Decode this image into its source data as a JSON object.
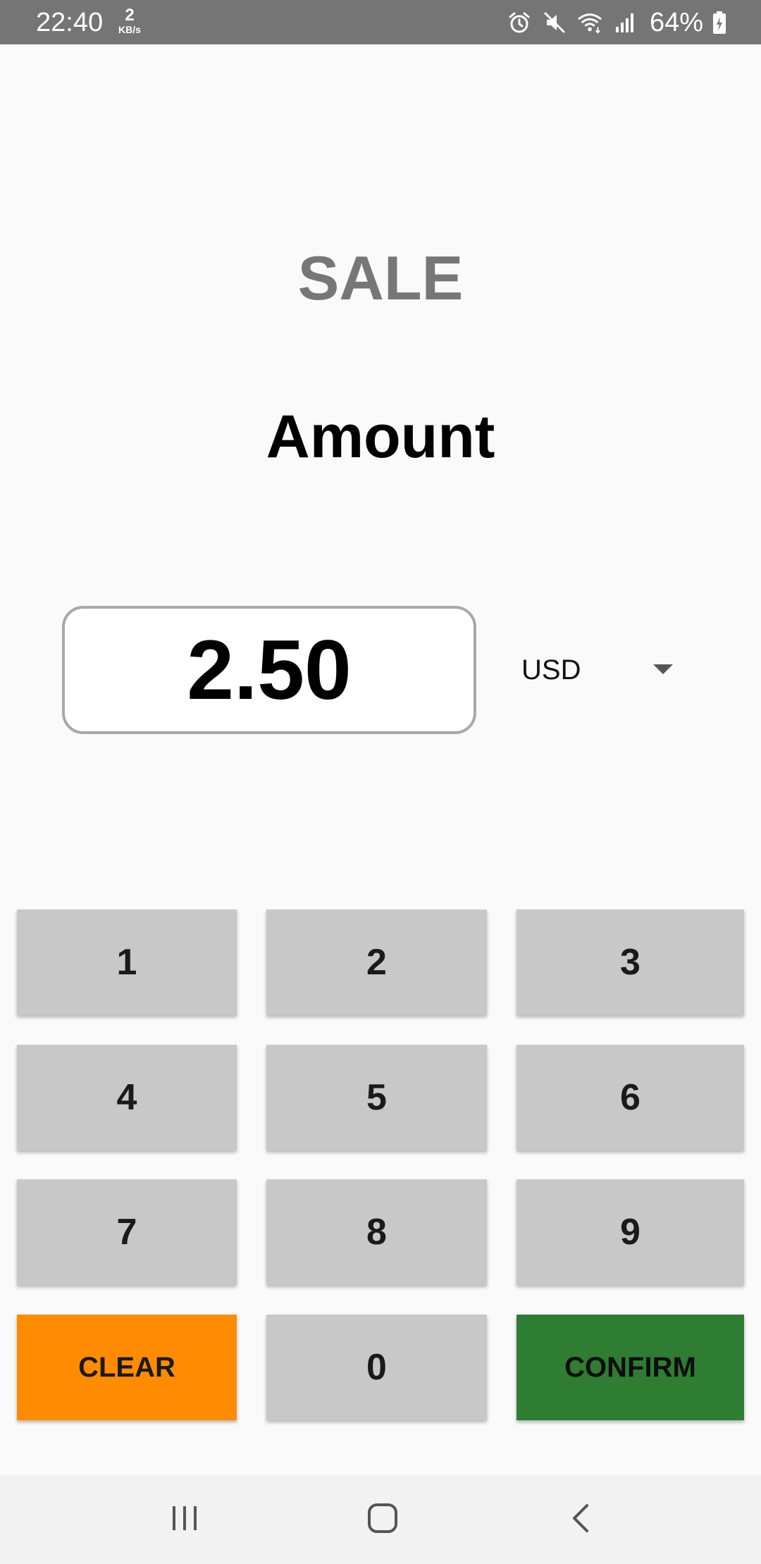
{
  "status_bar": {
    "time": "22:40",
    "net_speed_value": "2",
    "net_speed_unit": "KB/s",
    "battery_percent": "64%",
    "icons": [
      "alarm-icon",
      "mute-icon",
      "wifi-icon",
      "signal-icon",
      "battery-charging-icon"
    ]
  },
  "header": {
    "title": "SALE",
    "subtitle": "Amount"
  },
  "amount": {
    "value": "2.50",
    "currency": "USD"
  },
  "keypad": {
    "keys": [
      "1",
      "2",
      "3",
      "4",
      "5",
      "6",
      "7",
      "8",
      "9",
      "CLEAR",
      "0",
      "CONFIRM"
    ]
  },
  "nav_bar": {
    "icons": [
      "recent-apps-icon",
      "home-icon",
      "back-icon"
    ]
  },
  "colors": {
    "status_bar": "#757575",
    "background": "#fafafa",
    "key": "#c8c8c8",
    "clear": "#ff8c00",
    "confirm": "#2e7d32",
    "title_gray": "#777777"
  }
}
